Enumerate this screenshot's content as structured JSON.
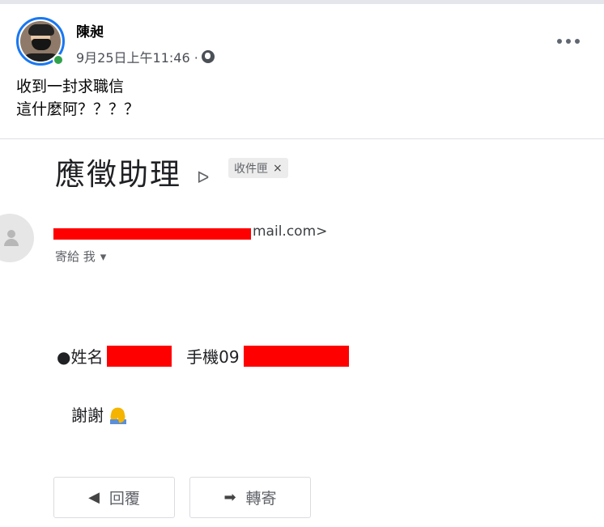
{
  "post": {
    "author": "陳昶",
    "timestamp": "9月25日上午11:46 ·",
    "text_line1": "收到一封求職信",
    "text_line2": "這什麼阿？？？？"
  },
  "email": {
    "subject": "應徵助理",
    "label_chip": "收件匣",
    "label_chip_close": "×",
    "sender_visible": "mail.com>",
    "to_label": "寄給 我",
    "to_dropdown": "▾",
    "body_name_label": "●姓名",
    "body_phone_label": "手機09",
    "thanks": "謝謝",
    "reply_label": "回覆",
    "forward_label": "轉寄",
    "important_icon": "ᐅ",
    "reply_icon": "◀",
    "forward_icon": "➡"
  },
  "colors": {
    "redaction": "#ff0000",
    "online": "#31a24c",
    "avatar_ring": "#1877f2"
  }
}
